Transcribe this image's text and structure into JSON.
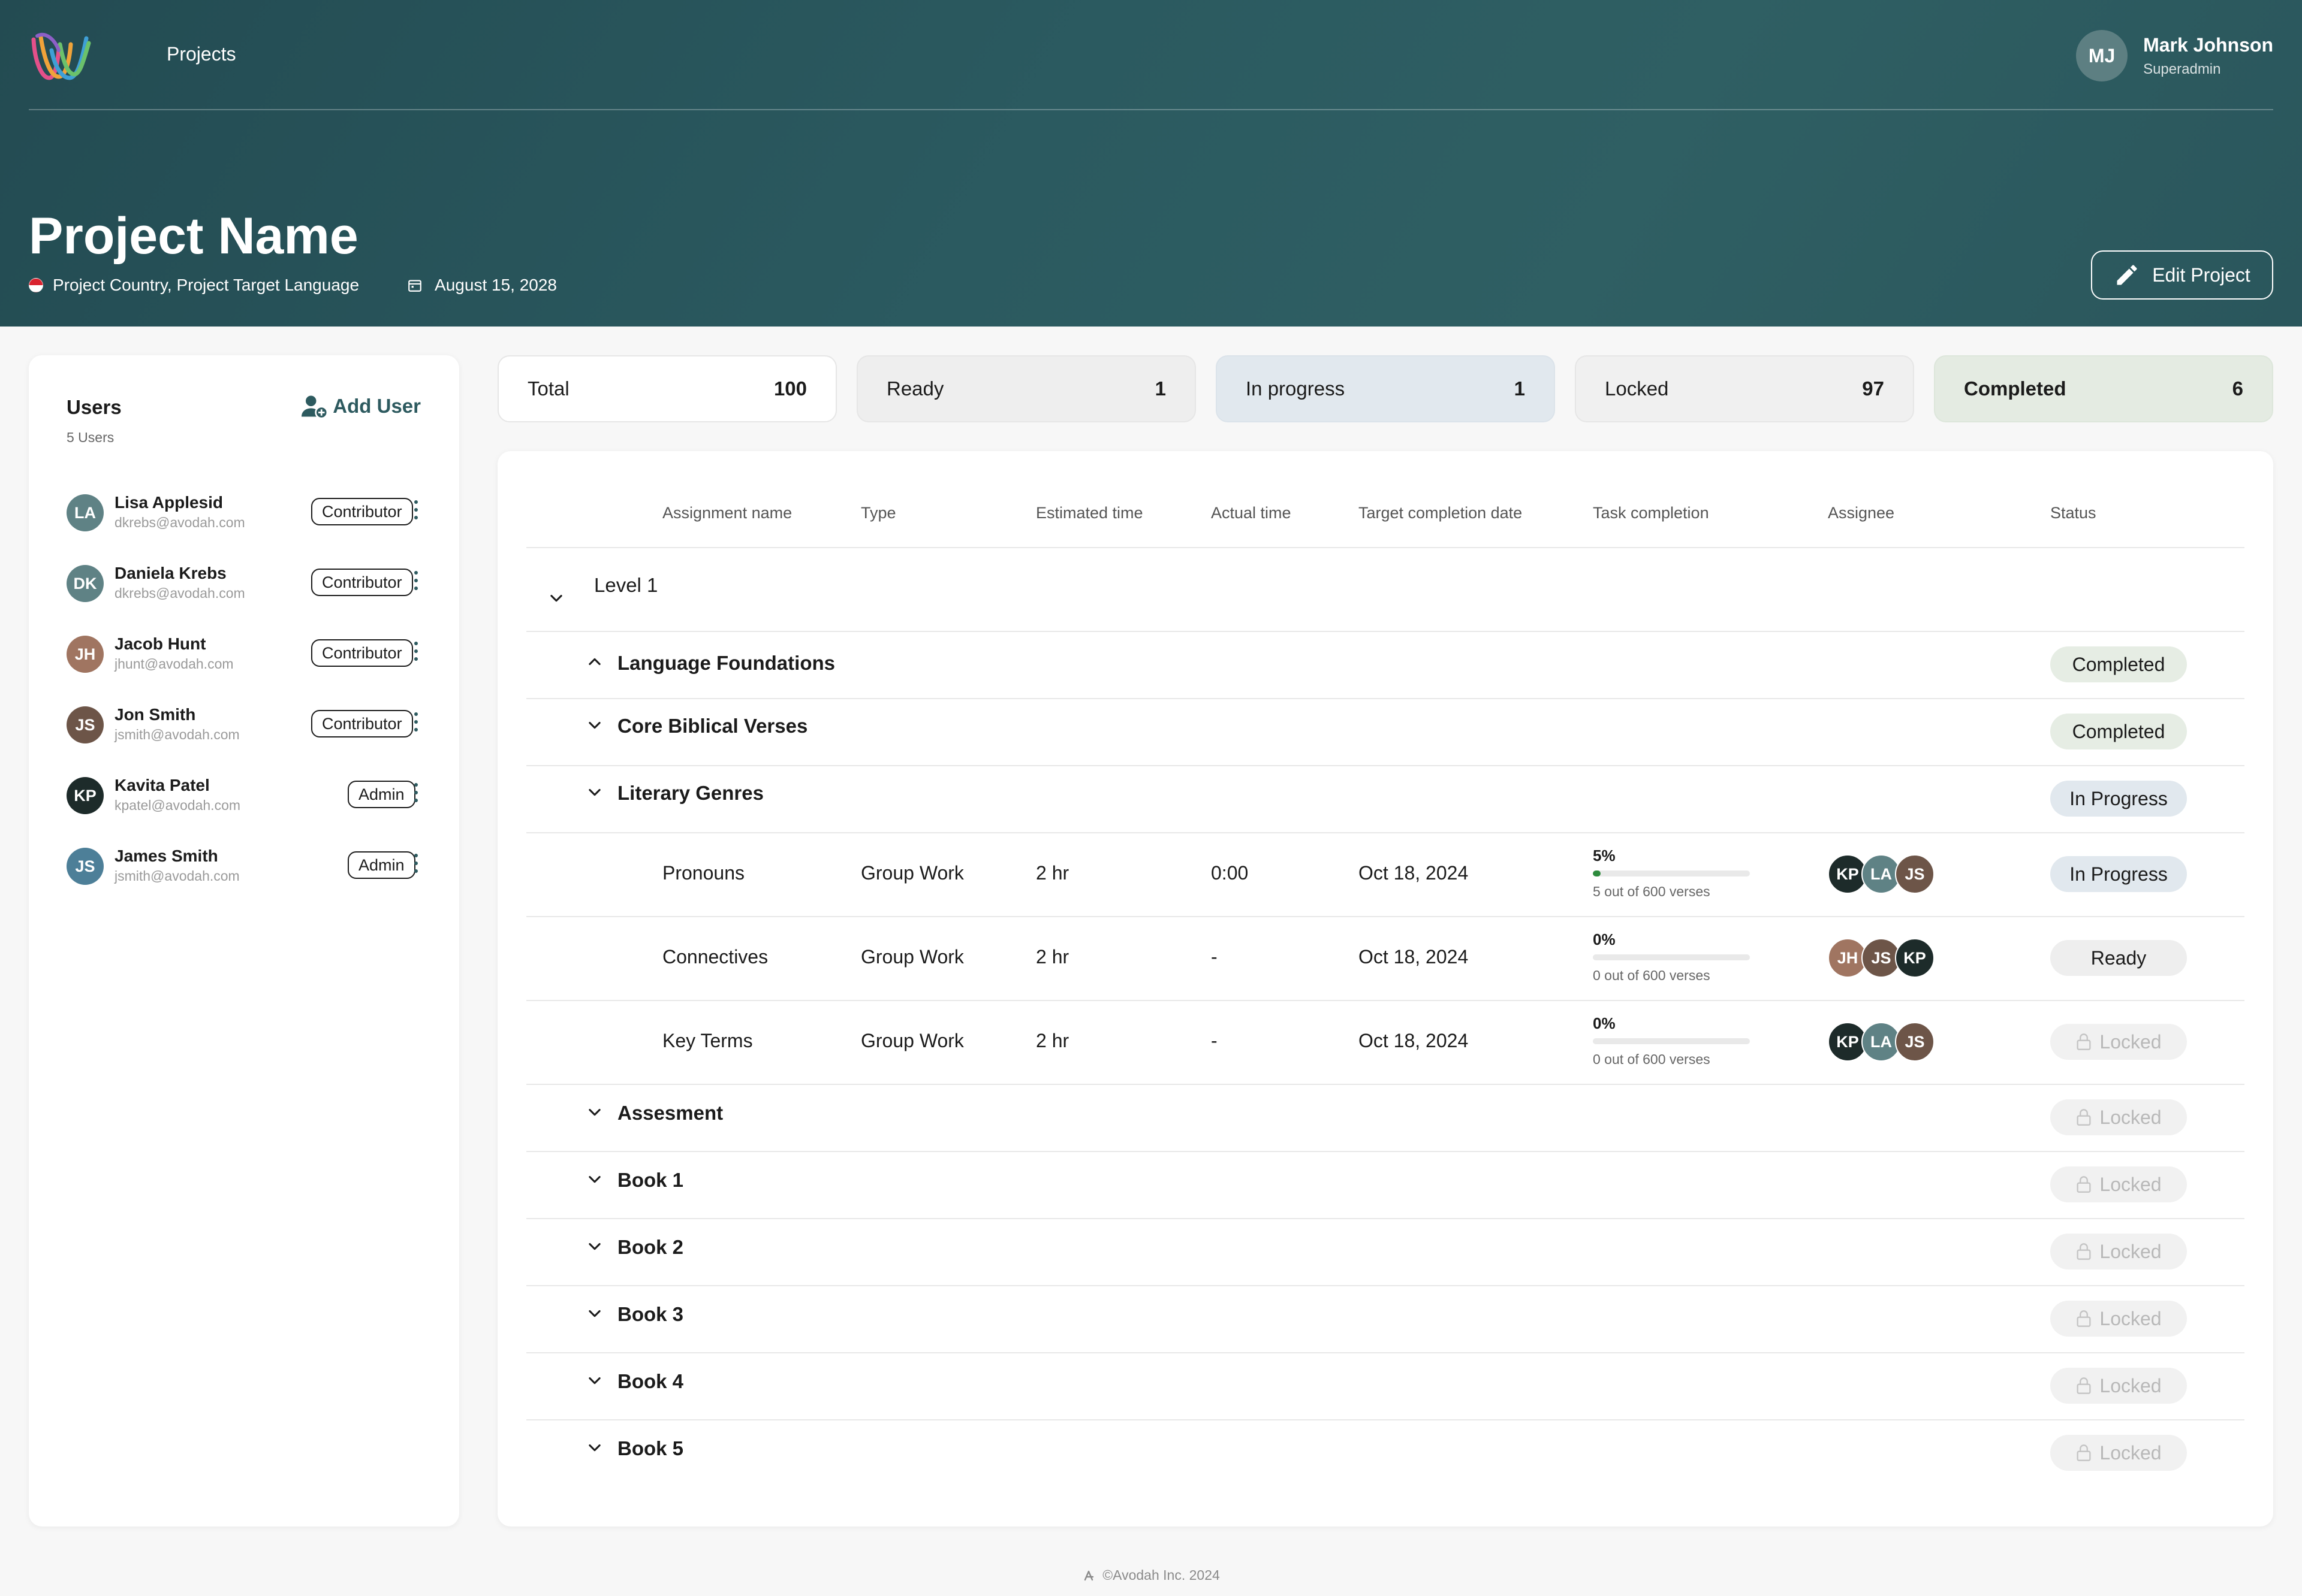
{
  "header": {
    "nav_projects": "Projects",
    "user": {
      "initials": "MJ",
      "name": "Mark Johnson",
      "role": "Superadmin"
    },
    "project_title": "Project Name",
    "project_location": "Project Country, Project Target Language",
    "project_date": "August 15, 2028",
    "edit_label": "Edit Project"
  },
  "users": {
    "title": "Users",
    "count": "5 Users",
    "add_label": "Add User",
    "list": [
      {
        "initials": "LA",
        "name": "Lisa Applesid",
        "email": "dkrebs@avodah.com",
        "role": "Contributor",
        "color": "#5f8285"
      },
      {
        "initials": "DK",
        "name": "Daniela Krebs",
        "email": "dkrebs@avodah.com",
        "role": "Contributor",
        "color": "#5f8285"
      },
      {
        "initials": "JH",
        "name": "Jacob Hunt",
        "email": "jhunt@avodah.com",
        "role": "Contributor",
        "color": "#a07561"
      },
      {
        "initials": "JS",
        "name": "Jon Smith",
        "email": "jsmith@avodah.com",
        "role": "Contributor",
        "color": "#6d5548"
      },
      {
        "initials": "KP",
        "name": "Kavita Patel",
        "email": "kpatel@avodah.com",
        "role": "Admin",
        "color": "#1d2b2a"
      },
      {
        "initials": "JS",
        "name": "James Smith",
        "email": "jsmith@avodah.com",
        "role": "Admin",
        "color": "#4d7f98"
      }
    ]
  },
  "stats": {
    "total": {
      "label": "Total",
      "value": "100"
    },
    "ready": {
      "label": "Ready",
      "value": "1"
    },
    "in_progress": {
      "label": "In progress",
      "value": "1"
    },
    "locked": {
      "label": "Locked",
      "value": "97"
    },
    "completed": {
      "label": "Completed",
      "value": "6"
    }
  },
  "table": {
    "columns": [
      "Assignment name",
      "Type",
      "Estimated time",
      "Actual time",
      "Target completion date",
      "Task completion",
      "Assignee",
      "Status"
    ],
    "level": "Level 1",
    "groups": [
      {
        "label": "Language Foundations",
        "status": "Completed",
        "expanded": true
      },
      {
        "label": "Core Biblical Verses",
        "status": "Completed",
        "expanded": false
      },
      {
        "label": "Literary Genres",
        "status": "In Progress",
        "expanded": false
      }
    ],
    "assignments": [
      {
        "name": "Pronouns",
        "type": "Group Work",
        "estimated": "2 hr",
        "actual": "0:00",
        "target": "Oct 18, 2024",
        "pct": "5%",
        "progress": 0.05,
        "verses": "5 out of 600 verses",
        "assignees": [
          "KP",
          "LA",
          "JS"
        ],
        "status": "In Progress"
      },
      {
        "name": "Connectives",
        "type": "Group Work",
        "estimated": "2 hr",
        "actual": "-",
        "target": "Oct 18, 2024",
        "pct": "0%",
        "progress": 0,
        "verses": "0 out of 600 verses",
        "assignees": [
          "JH",
          "JS",
          "KP"
        ],
        "status": "Ready"
      },
      {
        "name": "Key Terms",
        "type": "Group Work",
        "estimated": "2 hr",
        "actual": "-",
        "target": "Oct 18, 2024",
        "pct": "0%",
        "progress": 0,
        "verses": "0 out of 600 verses",
        "assignees": [
          "KP",
          "LA",
          "JS"
        ],
        "status": "Locked"
      }
    ],
    "locked_groups": [
      {
        "label": "Assesment",
        "status": "Locked"
      },
      {
        "label": "Book 1",
        "status": "Locked"
      },
      {
        "label": "Book 2",
        "status": "Locked"
      },
      {
        "label": "Book 3",
        "status": "Locked"
      },
      {
        "label": "Book 4",
        "status": "Locked"
      },
      {
        "label": "Book 5",
        "status": "Locked"
      }
    ]
  },
  "footer": {
    "text": "©Avodah Inc. 2024"
  }
}
